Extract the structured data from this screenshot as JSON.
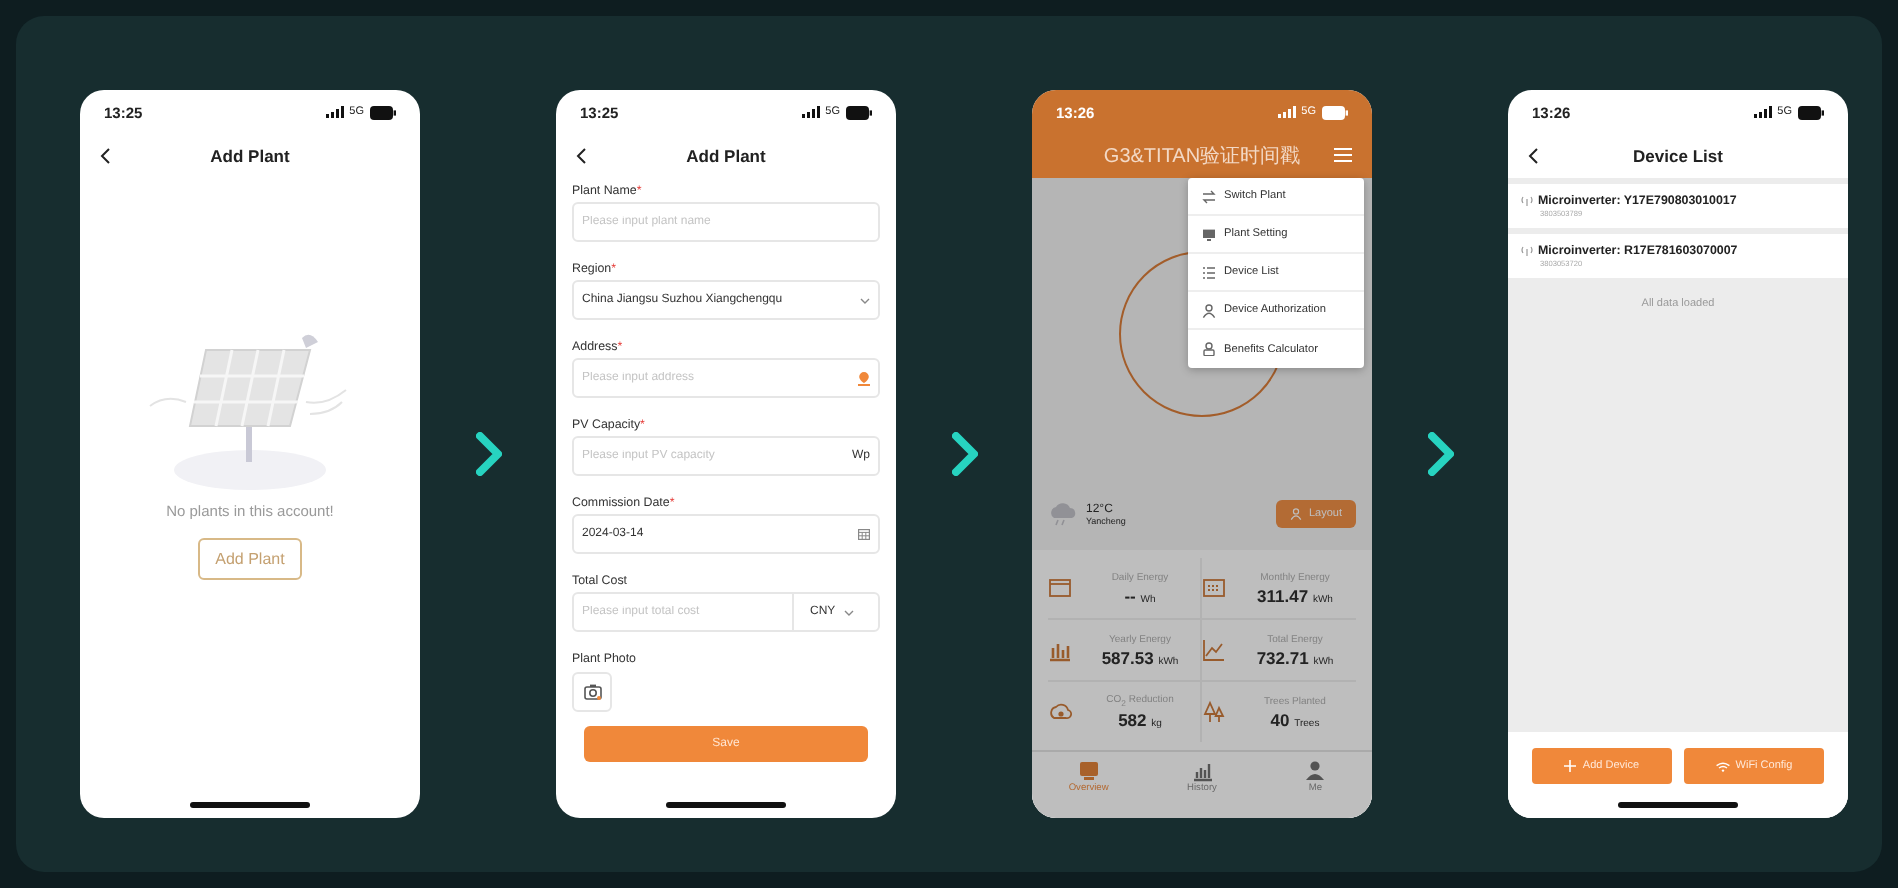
{
  "screens": [
    {
      "kind": "empty",
      "status": {
        "time": "13:25",
        "network": "5G"
      },
      "title": "Add Plant",
      "message": "No plants in this account!",
      "button": "Add Plant"
    },
    {
      "kind": "form",
      "status": {
        "time": "13:25",
        "network": "5G"
      },
      "title": "Add Plant",
      "fields": [
        {
          "kind": "text",
          "label": "Plant Name",
          "required": true,
          "placeholder": "Please input plant name"
        },
        {
          "kind": "select",
          "label": "Region",
          "required": true,
          "value": "China Jiangsu Suzhou Xiangchengqu"
        },
        {
          "kind": "address",
          "label": "Address",
          "required": true,
          "placeholder": "Please input address"
        },
        {
          "kind": "unit",
          "label": "PV Capacity",
          "required": true,
          "placeholder": "Please input PV capacity",
          "unit": "Wp"
        },
        {
          "kind": "date",
          "label": "Commission Date",
          "required": true,
          "value": "2024-03-14"
        },
        {
          "kind": "currency",
          "label": "Total Cost",
          "required": false,
          "placeholder": "Please input total cost",
          "unit": "CNY"
        }
      ],
      "required_mark": "*",
      "photo_label": "Plant Photo",
      "save": "Save"
    },
    {
      "kind": "overview",
      "status": {
        "time": "13:26",
        "network": "5G"
      },
      "title": "G3&TITAN验证时间戳",
      "menu": [
        "Switch Plant",
        "Plant Setting",
        "Device List",
        "Device Authorization",
        "Benefits Calculator"
      ],
      "weather": {
        "temperature": "12°C",
        "city": "Yancheng"
      },
      "layout_button": "Layout",
      "stats": [
        {
          "label": "Daily Energy",
          "value": "--",
          "unit": "Wh"
        },
        {
          "label": "Monthly Energy",
          "value": "311.47",
          "unit": "kWh"
        },
        {
          "label": "Yearly Energy",
          "value": "587.53",
          "unit": "kWh"
        },
        {
          "label": "Total Energy",
          "value": "732.71",
          "unit": "kWh"
        },
        {
          "label": "CO$_{2}$ Reduction",
          "value": "582",
          "unit": "kg"
        },
        {
          "label": "Trees Planted",
          "value": "40",
          "unit": "Trees"
        }
      ],
      "tabs": [
        {
          "label": "Overview",
          "selected": true
        },
        {
          "label": "History",
          "selected": false
        },
        {
          "label": "Me",
          "selected": false
        }
      ]
    },
    {
      "kind": "devices",
      "status": {
        "time": "13:26",
        "network": "5G"
      },
      "title": "Device List",
      "devices": [
        {
          "name": "Microinverter: Y17E790803010017",
          "serial": "3803503789"
        },
        {
          "name": "Microinverter: R17E781603070007",
          "serial": "3803053720"
        }
      ],
      "footer": "All data loaded",
      "buttons": [
        "Add Device",
        "WiFi Config"
      ]
    }
  ]
}
